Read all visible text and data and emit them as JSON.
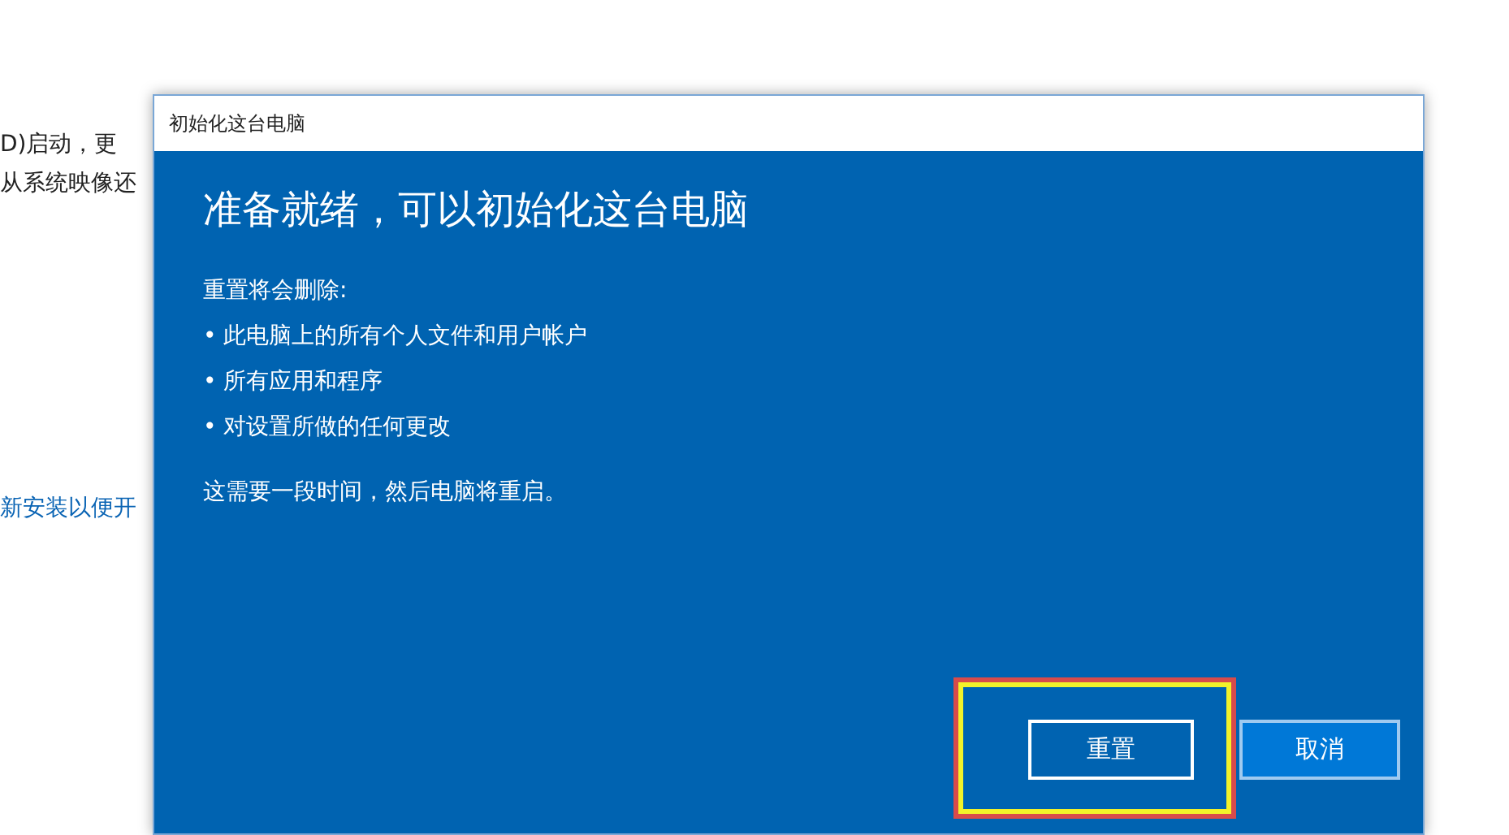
{
  "background_page": {
    "lines": [
      {
        "text": "D)启动，更",
        "kind": "text"
      },
      {
        "text": "从系统映像还",
        "kind": "text"
      },
      {
        "text": "新安装以便开",
        "kind": "link"
      }
    ]
  },
  "dialog": {
    "title": "初始化这台电脑",
    "heading": "准备就绪，可以初始化这台电脑",
    "intro": "重置将会删除:",
    "items": [
      "• 此电脑上的所有个人文件和用户帐户",
      "• 所有应用和程序",
      "• 对设置所做的任何更改"
    ],
    "note": "这需要一段时间，然后电脑将重启。",
    "buttons": [
      {
        "label": "重置",
        "kind": "primary",
        "highlighted": true
      },
      {
        "label": "取消",
        "kind": "secondary",
        "highlighted": false
      }
    ]
  }
}
